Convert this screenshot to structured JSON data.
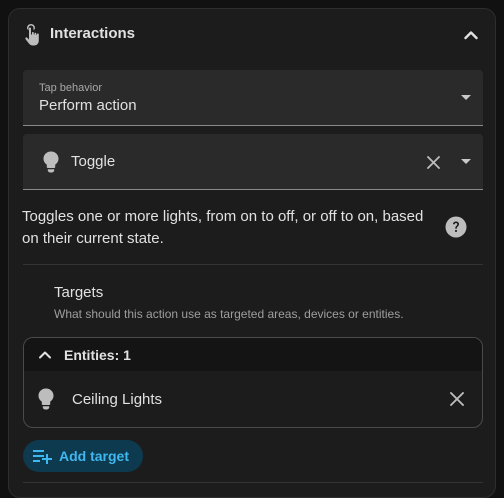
{
  "header": {
    "title": "Interactions",
    "icon": "gesture-tap-icon",
    "collapse_icon": "chevron-up-icon"
  },
  "tap_behavior": {
    "label": "Tap behavior",
    "value": "Perform action"
  },
  "action": {
    "icon": "lightbulb-icon",
    "value": "Toggle"
  },
  "description": "Toggles one or more lights, from on to off, or off to on, based on their current state.",
  "targets": {
    "title": "Targets",
    "subtitle": "What should this action use as targeted areas, devices or entities.",
    "entities_header": "Entities: 1",
    "entities": [
      {
        "name": "Ceiling Lights",
        "icon": "lightbulb-icon"
      }
    ],
    "add_label": "Add target"
  },
  "colors": {
    "accent": "#3fb7ef",
    "accent_bg": "#0d3a4f",
    "panel_bg": "#1c1c1c",
    "field_bg": "#2a2a2a"
  }
}
